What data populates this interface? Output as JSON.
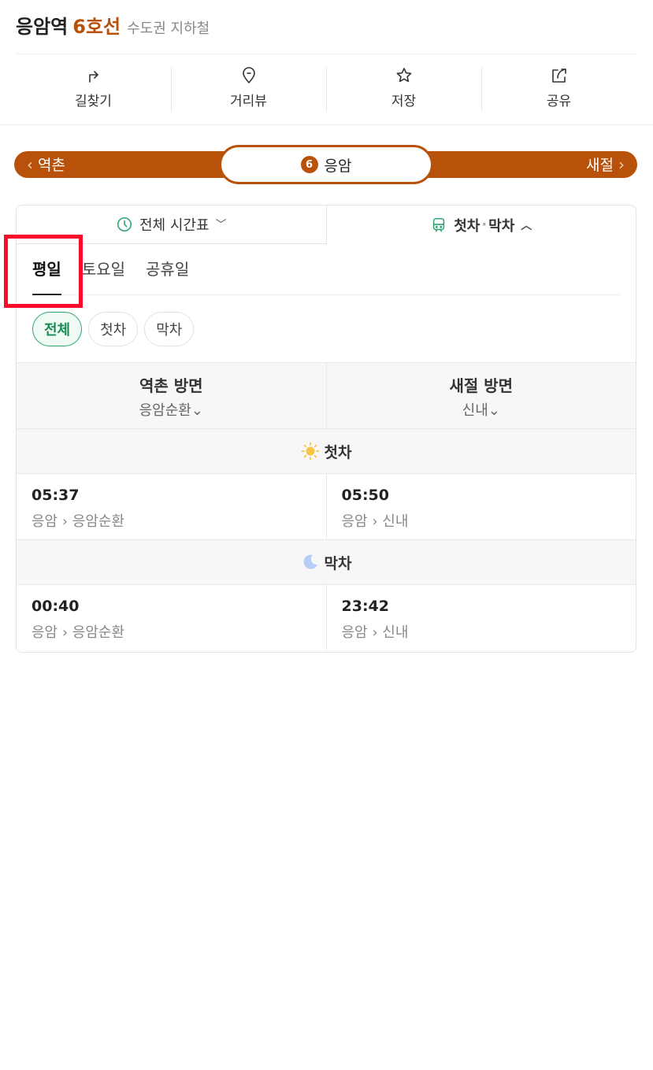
{
  "header": {
    "station": "응암역",
    "line": "6호선",
    "region": "수도권 지하철"
  },
  "actions": [
    {
      "label": "길찾기",
      "icon": "turn-right-arrow-icon"
    },
    {
      "label": "거리뷰",
      "icon": "map-pin-icon"
    },
    {
      "label": "저장",
      "icon": "star-icon"
    },
    {
      "label": "공유",
      "icon": "share-icon"
    }
  ],
  "line_bar": {
    "prev": "역촌",
    "current": "응암",
    "line_number": "6",
    "next": "새절",
    "color": "#b8520a"
  },
  "view_tabs": {
    "full": "전체 시간표",
    "first": "첫차",
    "last": "막차"
  },
  "day_tabs": [
    "평일",
    "토요일",
    "공휴일"
  ],
  "filters": [
    "전체",
    "첫차",
    "막차"
  ],
  "directions": [
    {
      "title": "역촌 방면",
      "sub": "응암순환"
    },
    {
      "title": "새절 방면",
      "sub": "신내"
    }
  ],
  "first_section": {
    "label": "첫차",
    "rows": [
      {
        "time": "05:37",
        "route": "응암 › 응암순환"
      },
      {
        "time": "05:50",
        "route": "응암 › 신내"
      }
    ]
  },
  "last_section": {
    "label": "막차",
    "rows": [
      {
        "time": "00:40",
        "route": "응암 › 응암순환"
      },
      {
        "time": "23:42",
        "route": "응암 › 신내"
      }
    ]
  },
  "accent_green": "#2fa56e"
}
